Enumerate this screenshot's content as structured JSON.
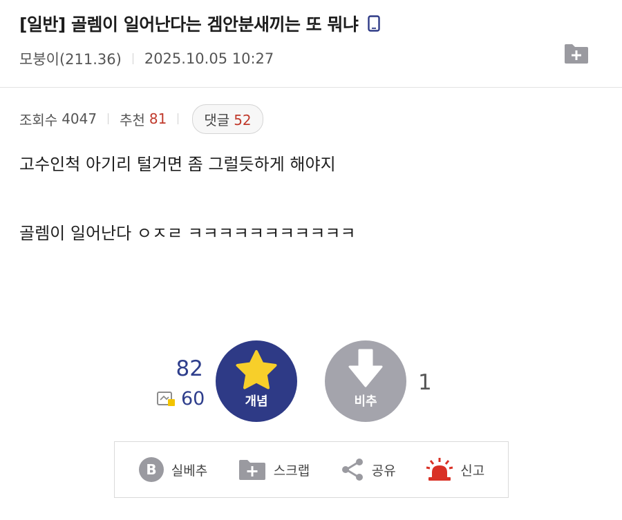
{
  "post": {
    "title": "[일반] 골렘이 일어난다는 겜안분새끼는 또 뭐냐",
    "author": "모붕이(211.36)",
    "datetime": "2025.10.05 10:27"
  },
  "stats": {
    "views_label": "조회수",
    "views": "4047",
    "recommend_label": "추천",
    "recommend": "81",
    "comments_label": "댓글",
    "comments": "52"
  },
  "body": {
    "line1": "고수인척 아기리 털거면 좀 그럴듯하게 해야지",
    "line2": "골렘이 일어난다 ㅇㅈㄹ ㅋㅋㅋㅋㅋㅋㅋㅋㅋㅋㅋ"
  },
  "votes": {
    "up_count": "82",
    "fixed_count": "60",
    "up_label": "개념",
    "down_label": "비추",
    "down_count": "1"
  },
  "actions": {
    "best_label": "실베추",
    "scrap_label": "스크랩",
    "share_label": "공유",
    "report_label": "신고"
  },
  "colors": {
    "accent_navy": "#2e3a86",
    "count_red": "#c0392b",
    "vote_down_gray": "#a4a4ac",
    "icon_gray": "#9a9aa0",
    "report_red": "#d93025"
  },
  "icons": {
    "title": "mobile-phone-icon",
    "folder": "folder-add-icon",
    "up": "star-icon",
    "down": "arrow-down-icon",
    "fixed": "fixed-user-icon",
    "best": "b-circle-icon",
    "scrap": "folder-plus-icon",
    "share": "share-icon",
    "report": "siren-icon"
  }
}
